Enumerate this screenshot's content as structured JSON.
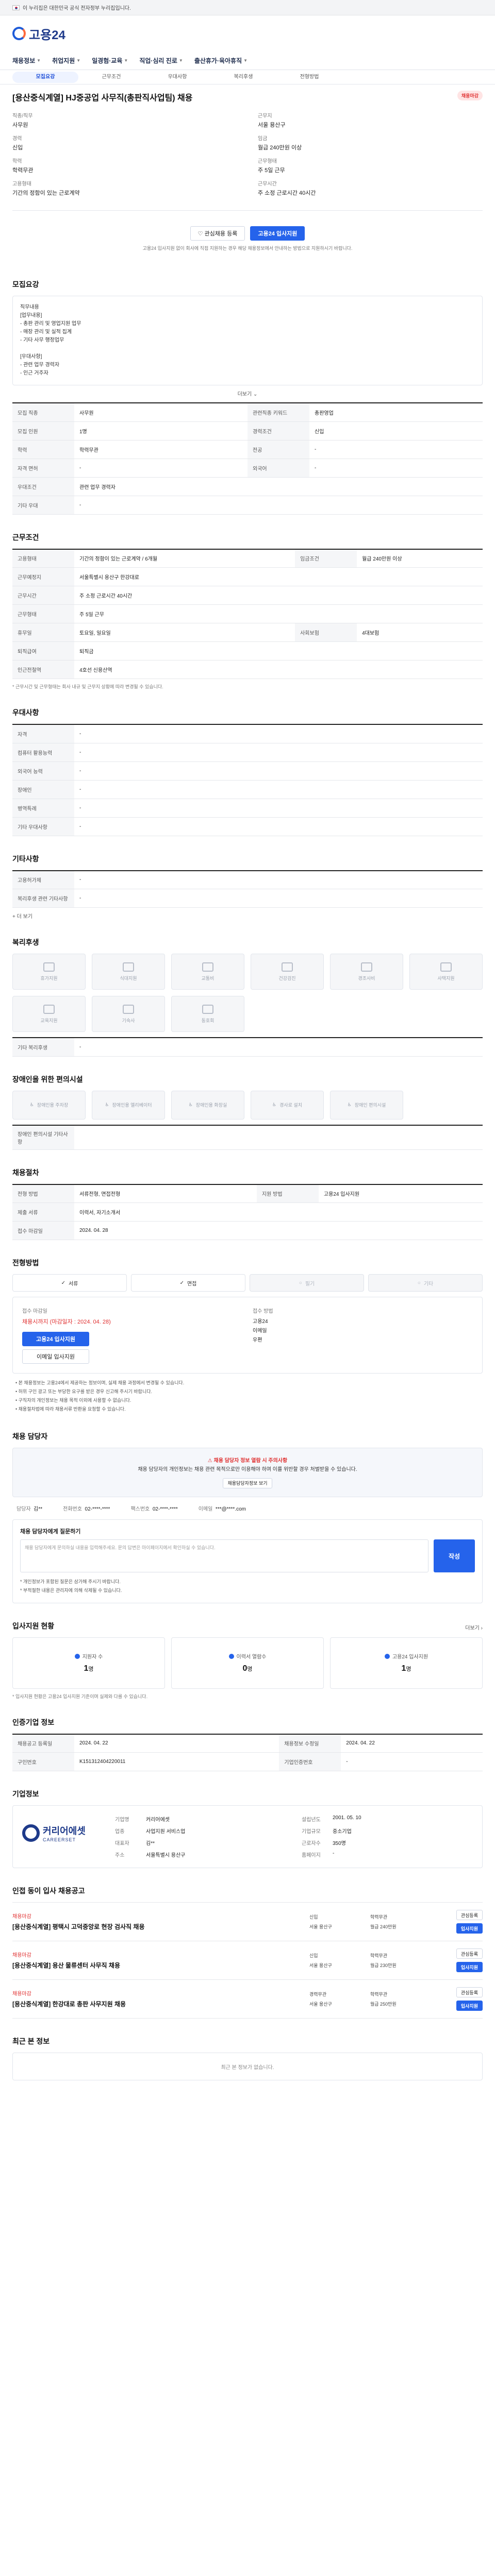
{
  "gov_banner": {
    "text": "이 누리집은 대한민국 공식 전자정부 누리집입니다."
  },
  "header": {
    "logo": "고용24"
  },
  "gnb": {
    "items": [
      "채용정보",
      "취업지원",
      "일경험·교육",
      "직업·심리 진로",
      "출산휴가·육아휴직"
    ]
  },
  "tabs": [
    "모집요강",
    "근무조건",
    "우대사항",
    "복리후생",
    "전형방법"
  ],
  "job": {
    "title": "[용산중식계열] HJ중공업 사무직(총판직사업팀) 채용",
    "badge": "채용마감",
    "fields": [
      {
        "label": "직종/직무",
        "value": "사무원"
      },
      {
        "label": "근무지",
        "value": "서울 용산구"
      },
      {
        "label": "경력",
        "value": "신입"
      },
      {
        "label": "임금",
        "value": "월급 240만원 이상"
      },
      {
        "label": "학력",
        "value": "학력무관"
      },
      {
        "label": "근무형태",
        "value": "주 5일 근무"
      },
      {
        "label": "고용형태",
        "value": "기간의 정함이 있는 근로계약"
      },
      {
        "label": "근무시간",
        "value": "주 소정 근로시간 40시간"
      }
    ],
    "actions": {
      "save": "관심채용 등록",
      "apply": "고용24 입사지원"
    },
    "notice": "고용24 입사지원 없이 회사에 직접 지원하는 경우 해당 채용정보에서 안내하는 방법으로 지원하시기 바랍니다."
  },
  "sections": {
    "recruit_title": "모집요강",
    "recruit_body": "직무내용\n[업무내용]\n- 총판 관리 및 영업지원 업무\n- 매장 관리 및 실적 집계\n- 기타 사무 행정업무\n\n[우대사항]\n- 관련 업무 경력자\n- 인근 거주자",
    "more": "더보기",
    "recruit_table": [
      [
        "모집 직종",
        "사무원",
        "관련직종 키워드",
        "총판영업"
      ],
      [
        "모집 인원",
        "1명",
        "경력조건",
        "신입"
      ],
      [
        "학력",
        "학력무관",
        "전공",
        "-"
      ],
      [
        "자격 면허",
        "-",
        "외국어",
        "-"
      ],
      [
        "우대조건",
        "관련 업무 경력자",
        "",
        ""
      ],
      [
        "기타 우대",
        "-",
        "",
        ""
      ]
    ],
    "work_title": "근무조건",
    "work_table": [
      [
        "고용형태",
        "기간의 정함이 있는 근로계약 / 6개월",
        "임금조건",
        "월급 240만원 이상"
      ],
      [
        "근무예정지",
        "서울특별시 용산구 한강대로",
        "",
        ""
      ],
      [
        "근무시간",
        "주 소정 근로시간 40시간",
        "",
        ""
      ],
      [
        "근무형태",
        "주 5일 근무",
        "",
        ""
      ],
      [
        "휴무일",
        "토요일, 일요일",
        "사회보험",
        "4대보험"
      ],
      [
        "퇴직급여",
        "퇴직금",
        "",
        ""
      ],
      [
        "인근전철역",
        "4호선 신용산역",
        "",
        ""
      ]
    ],
    "work_note": "* 근무시간 및 근무형태는 회사 내규 및 근무지 상황에 따라 변경될 수 있습니다.",
    "pref_title": "우대사항",
    "pref_table": [
      [
        "자격",
        "-"
      ],
      [
        "컴퓨터 활용능력",
        "-"
      ],
      [
        "외국어 능력",
        "-"
      ],
      [
        "장애인",
        "-"
      ],
      [
        "병역특례",
        "-"
      ],
      [
        "기타 우대사항",
        "-"
      ]
    ],
    "etc_title": "기타사항",
    "etc_table": [
      [
        "고용허가제",
        "-"
      ],
      [
        "복리후생 관련 기타사항",
        "-"
      ]
    ],
    "etc_more": "더 보기",
    "benefit_title": "복리후생",
    "benefits": [
      "휴가지원",
      "식대지원",
      "교통비",
      "건강검진",
      "경조사비",
      "사택지원",
      "교육지원",
      "기숙사",
      "동호회"
    ],
    "benefit_extra_label": "기타 복리후생",
    "benefit_extra_value": "-",
    "access_title": "장애인을 위한 편의시설",
    "access_items": [
      "장애인용 주차장",
      "장애인용 엘리베이터",
      "장애인용 화장실",
      "경사로 설치",
      "장애인 편의시설"
    ],
    "access_extra_label": "장애인 편의시설 기타사항",
    "apply_cond_title": "채용절차",
    "apply_cond_table": [
      [
        "전형 방법",
        "서류전형, 면접전형",
        "지원 방법",
        "고용24 입사지원"
      ],
      [
        "제출 서류",
        "이력서, 자기소개서",
        "",
        ""
      ],
      [
        "접수 마감일",
        "2024. 04. 28",
        "",
        ""
      ]
    ],
    "method_title": "전형방법",
    "methods": [
      {
        "label": "서류",
        "on": true
      },
      {
        "label": "면접",
        "on": true
      },
      {
        "label": "필기",
        "on": false
      },
      {
        "label": "기타",
        "on": false
      }
    ],
    "apply_box": {
      "left_title": "접수 마감일",
      "left_value": "채용시까지 (마감일자 : 2024. 04. 28)",
      "apply_btn": "고용24 입사지원",
      "save_btn": "이메일 입사지원",
      "right_title": "접수 방법",
      "right_lines": [
        "고용24",
        "이메일",
        "우편"
      ]
    },
    "bullets": [
      "본 채용정보는 고용24에서 제공하는 정보이며, 실제 채용 과정에서 변경될 수 있습니다.",
      "허위 구인 광고 또는 부당한 요구를 받은 경우 신고해 주시기 바랍니다.",
      "구직자의 개인정보는 채용 목적 이외에 사용할 수 없습니다.",
      "채용절차법에 따라 채용서류 반환을 요청할 수 있습니다."
    ],
    "contact_title": "채용 담당자",
    "warn_head": "채용 담당자 정보 열람 시 주의사항",
    "warn_text": "채용 담당자의 개인정보는 채용 관련 목적으로만 이용해야 하며 이를 위반할 경우 처벌받을 수 있습니다.",
    "warn_btn": "채용담당자정보 보기",
    "contact": {
      "name_label": "담당자",
      "name": "김**",
      "phone_label": "전화번호",
      "phone": "02-****-****",
      "fax_label": "팩스번호",
      "fax": "02-****-****",
      "email_label": "이메일",
      "email": "***@****.com"
    },
    "msg_title": "채용 담당자에게 질문하기",
    "msg_placeholder": "채용 담당자에게 문의하실 내용을 입력해주세요. 문의 답변은 마이페이지에서 확인하실 수 있습니다.",
    "msg_send": "작성",
    "msg_notes": [
      "* 개인정보가 포함된 질문은 삼가해 주시기 바랍니다.",
      "* 부적절한 내용은 관리자에 의해 삭제될 수 있습니다."
    ],
    "stat_title": "입사지원 현황",
    "stat_more": "더보기",
    "stats": [
      {
        "label": "지원자 수",
        "value": "1",
        "unit": "명"
      },
      {
        "label": "이력서 열람수",
        "value": "0",
        "unit": "명"
      },
      {
        "label": "고용24 입사지원",
        "value": "1",
        "unit": "명"
      }
    ],
    "stat_note": "* 입사지원 현황은 고용24 입사지원 기준이며 실제와 다를 수 있습니다.",
    "manage_title": "인증기업 정보",
    "manage_table": [
      [
        "채용공고 등록일",
        "2024. 04. 22",
        "채용정보 수정일",
        "2024. 04. 22"
      ],
      [
        "구인번호",
        "K151312404220011",
        "기업인증번호",
        "-"
      ]
    ],
    "company_title": "기업정보",
    "company": {
      "logo_main": "커리어에셋",
      "logo_sub": "CAREERSET",
      "rows": [
        [
          "기업명",
          "커리어에셋",
          "설립년도",
          "2001. 05. 10"
        ],
        [
          "업종",
          "사업지원 서비스업",
          "기업규모",
          "중소기업"
        ],
        [
          "대표자",
          "김**",
          "근로자수",
          "350명"
        ],
        [
          "주소",
          "서울특별시 용산구",
          "홈페이지",
          "-"
        ]
      ]
    },
    "list_title": "인접 동이 입사 채용공고",
    "job_list": [
      {
        "corp": "채용마감",
        "title": "[용산중식계열] 평택시 고덕중앙로 현장 검사직 채용",
        "m": [
          "신입",
          "학력무관",
          "서울 용산구",
          "월급 240만원"
        ],
        "btn1": "관심등록",
        "btn2": "입사지원"
      },
      {
        "corp": "채용마감",
        "title": "[용산중식계열] 용산 물류센터 사무직 채용",
        "m": [
          "신입",
          "학력무관",
          "서울 용산구",
          "월급 230만원"
        ],
        "btn1": "관심등록",
        "btn2": "입사지원"
      },
      {
        "corp": "채용마감",
        "title": "[용산중식계열] 한강대로 총판 사무지원 채용",
        "m": [
          "경력무관",
          "학력무관",
          "서울 용산구",
          "월급 250만원"
        ],
        "btn1": "관심등록",
        "btn2": "입사지원"
      }
    ],
    "recent_title": "최근 본 정보",
    "recent_empty": "최근 본 정보가 없습니다."
  }
}
